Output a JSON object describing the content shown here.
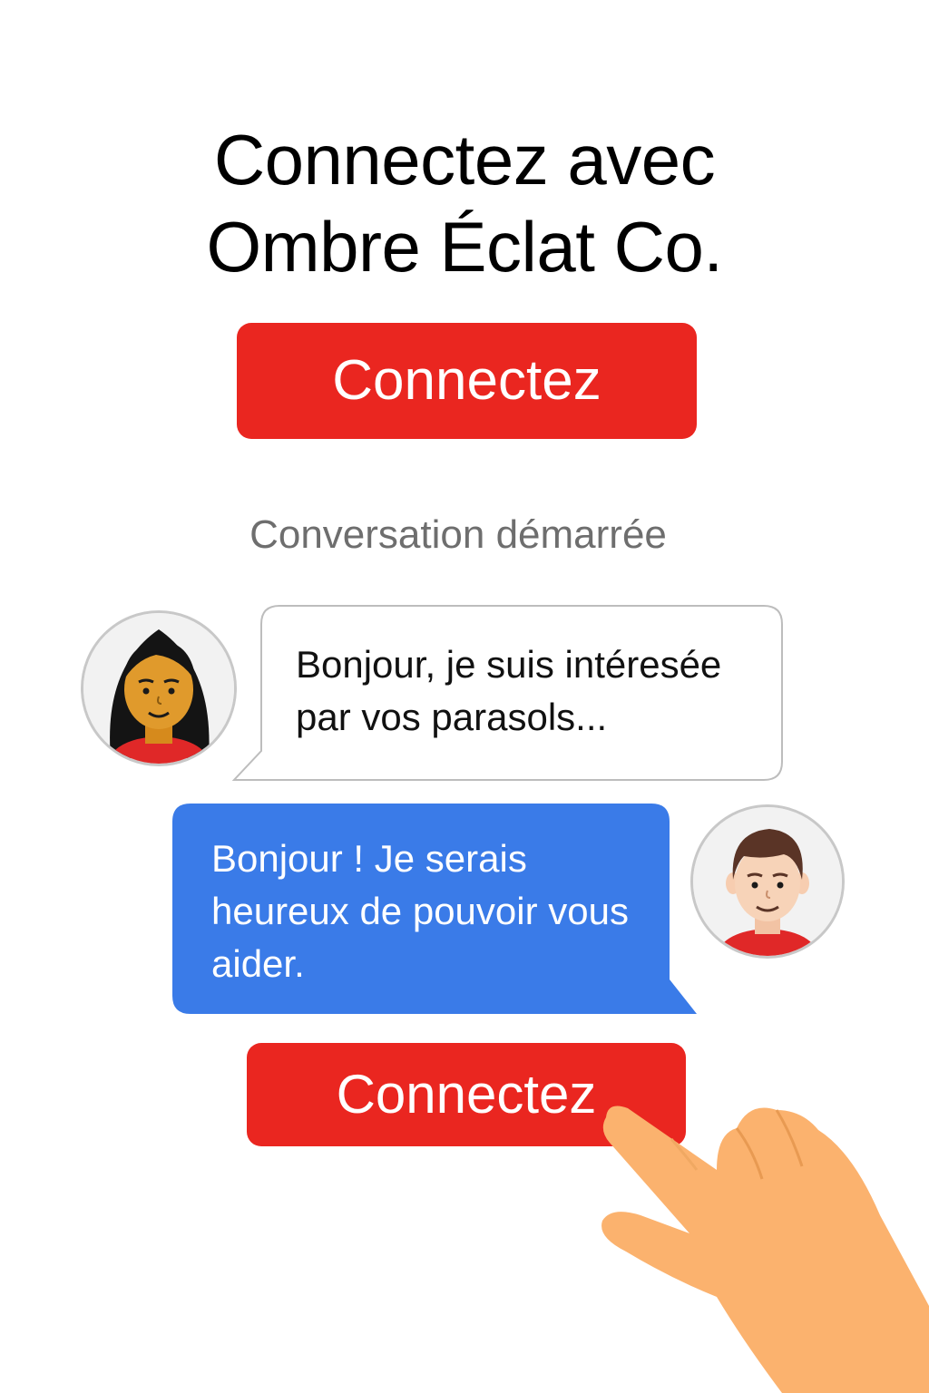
{
  "header": {
    "title_line1": "Connectez avec",
    "title_line2": "Ombre Éclat Co."
  },
  "connect_button_top": {
    "label": "Connectez"
  },
  "status_text": "Conversation démarrée",
  "messages": [
    {
      "sender": "customer",
      "lines": [
        "Bonjour, je suis intéresée",
        "par vos parasols..."
      ]
    },
    {
      "sender": "agent",
      "lines": [
        "Bonjour ! Je serais",
        "heureux de pouvoir vous",
        "aider."
      ]
    }
  ],
  "connect_button_bottom": {
    "label": "Connectez"
  },
  "colors": {
    "accent_red": "#ea2620",
    "agent_bubble_blue": "#3a7be8",
    "customer_bubble_border": "#bdbdbd",
    "skin_hand": "#fbb26e"
  },
  "icons": {
    "customer_avatar": "woman-avatar-icon",
    "agent_avatar": "man-avatar-icon",
    "pointer": "pointing-hand-icon"
  }
}
